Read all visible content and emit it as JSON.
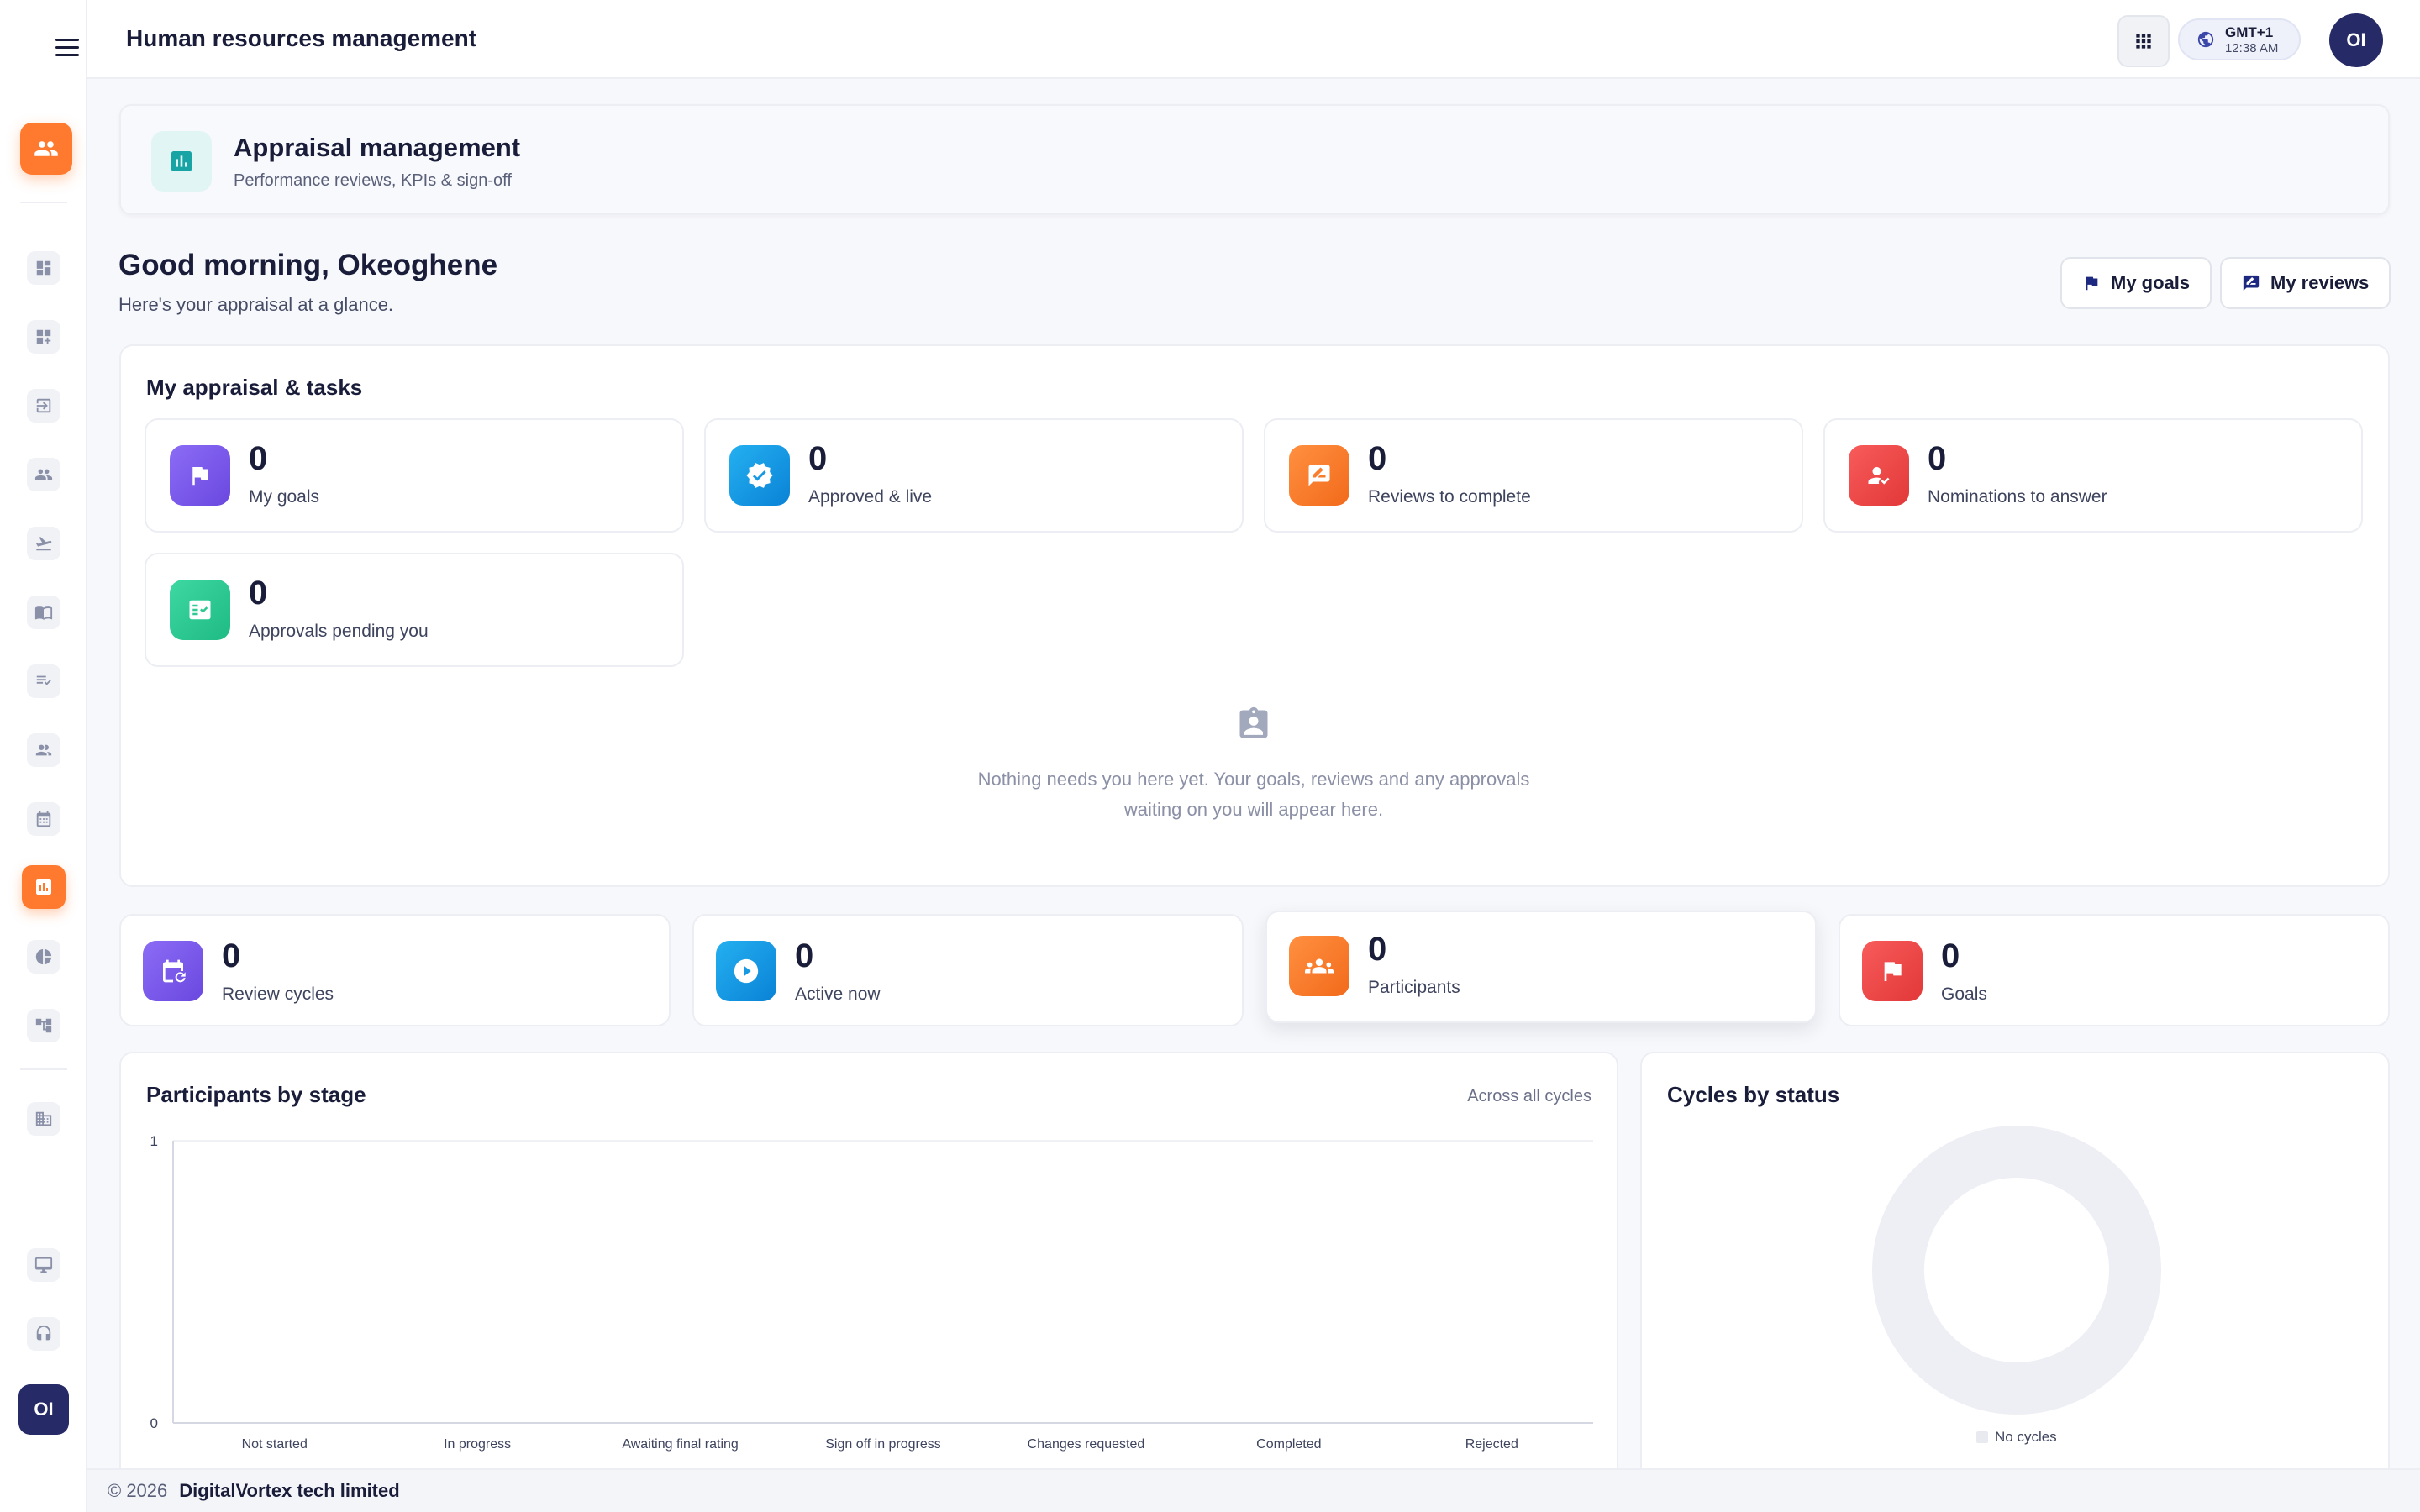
{
  "header": {
    "title": "Human resources management",
    "timezone": "GMT+1",
    "time": "12:38 AM",
    "avatar_initials": "OI"
  },
  "sidebar": {
    "avatar_initials": "OI",
    "items": [
      {
        "icon": "dashboard-icon"
      },
      {
        "icon": "add-widget-icon"
      },
      {
        "icon": "login-icon"
      },
      {
        "icon": "people-icon"
      },
      {
        "icon": "flight-takeoff-icon"
      },
      {
        "icon": "book-icon"
      },
      {
        "icon": "checklist-icon"
      },
      {
        "icon": "group-icon"
      },
      {
        "icon": "calendar-icon"
      },
      {
        "icon": "appraisal-icon",
        "active": true
      },
      {
        "icon": "pie-chart-icon"
      },
      {
        "icon": "org-chart-icon"
      },
      {
        "icon": "building-icon"
      },
      {
        "icon": "desktop-icon"
      },
      {
        "icon": "support-icon"
      }
    ]
  },
  "module": {
    "title": "Appraisal management",
    "subtitle": "Performance reviews, KPIs & sign-off"
  },
  "greeting": {
    "title": "Good morning, Okeoghene",
    "subtitle": "Here's your appraisal at a glance."
  },
  "actions": {
    "my_goals": "My goals",
    "my_reviews": "My reviews"
  },
  "tasks": {
    "title": "My appraisal & tasks",
    "stats": [
      {
        "value": "0",
        "label": "My goals",
        "color": "#7c5cf0"
      },
      {
        "value": "0",
        "label": "Approved & live",
        "color": "#1597e5"
      },
      {
        "value": "0",
        "label": "Reviews to complete",
        "color": "#ff7a2f"
      },
      {
        "value": "0",
        "label": "Nominations to answer",
        "color": "#f04848"
      },
      {
        "value": "0",
        "label": "Approvals pending you",
        "color": "#2ccb93"
      }
    ],
    "empty_text": "Nothing needs you here yet. Your goals, reviews and any approvals waiting on you will appear here."
  },
  "summary": [
    {
      "value": "0",
      "label": "Review cycles",
      "color": "#7c5cf0"
    },
    {
      "value": "0",
      "label": "Active now",
      "color": "#1597e5"
    },
    {
      "value": "0",
      "label": "Participants",
      "color": "#ff7a2f"
    },
    {
      "value": "0",
      "label": "Goals",
      "color": "#f04848"
    }
  ],
  "participants_chart": {
    "title": "Participants by stage",
    "scope": "Across all cycles"
  },
  "cycles_chart": {
    "title": "Cycles by status",
    "legend": "No cycles"
  },
  "chart_data": [
    {
      "type": "bar",
      "title": "Participants by stage",
      "categories": [
        "Not started",
        "In progress",
        "Awaiting final rating",
        "Sign off in progress",
        "Changes requested",
        "Completed",
        "Rejected"
      ],
      "values": [
        0,
        0,
        0,
        0,
        0,
        0,
        0
      ],
      "ylim": [
        0,
        1
      ],
      "yticks": [
        "0",
        "1"
      ]
    },
    {
      "type": "pie",
      "title": "Cycles by status",
      "labels": [
        "No cycles"
      ],
      "values": [
        0
      ]
    }
  ],
  "footer": {
    "year": "© 2026",
    "company": "DigitalVortex tech limited"
  }
}
